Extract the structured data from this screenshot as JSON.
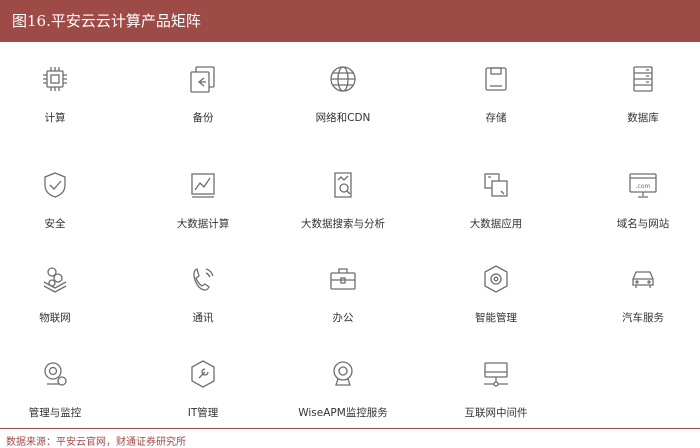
{
  "title": "图16.平安云云计算产品矩阵",
  "source": "数据来源：平安云官网，财通证券研究所",
  "colors": {
    "accent": "#9e4b47",
    "icon": "#6e6e6e"
  },
  "products": [
    {
      "label": "计算",
      "icon": "cpu-icon"
    },
    {
      "label": "备份",
      "icon": "backup-icon"
    },
    {
      "label": "网络和CDN",
      "icon": "globe-icon"
    },
    {
      "label": "存储",
      "icon": "storage-icon"
    },
    {
      "label": "数据库",
      "icon": "database-icon"
    },
    {
      "label": "安全",
      "icon": "shield-icon"
    },
    {
      "label": "大数据计算",
      "icon": "chart-icon"
    },
    {
      "label": "大数据搜索与分析",
      "icon": "search-doc-icon"
    },
    {
      "label": "大数据应用",
      "icon": "app-icon"
    },
    {
      "label": "域名与网站",
      "icon": "website-icon"
    },
    {
      "label": "物联网",
      "icon": "iot-icon"
    },
    {
      "label": "通讯",
      "icon": "phone-icon"
    },
    {
      "label": "办公",
      "icon": "briefcase-icon"
    },
    {
      "label": "智能管理",
      "icon": "gear-icon"
    },
    {
      "label": "汽车服务",
      "icon": "car-icon"
    },
    {
      "label": "管理与监控",
      "icon": "monitor-icon"
    },
    {
      "label": "IT管理",
      "icon": "wrench-icon"
    },
    {
      "label": "WiseAPM监控服务",
      "icon": "camera-icon"
    },
    {
      "label": "互联网中间件",
      "icon": "server-icon"
    }
  ]
}
